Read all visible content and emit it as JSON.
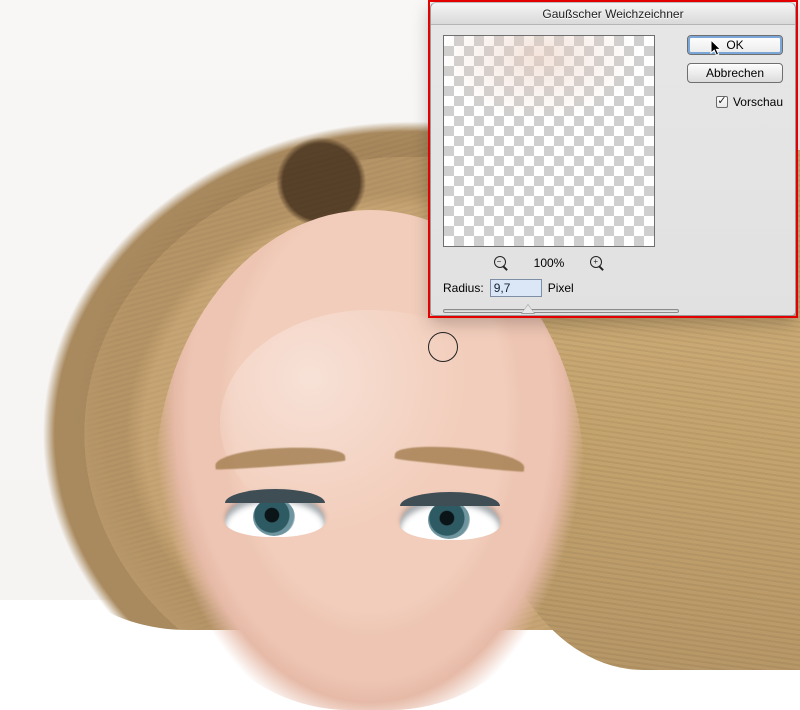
{
  "dialog": {
    "title": "Gaußscher Weichzeichner",
    "ok_label": "OK",
    "cancel_label": "Abbrechen",
    "preview_label": "Vorschau",
    "preview_checked": true,
    "zoom_percent": "100%",
    "radius_label": "Radius:",
    "radius_value": "9,7",
    "radius_unit": "Pixel"
  }
}
